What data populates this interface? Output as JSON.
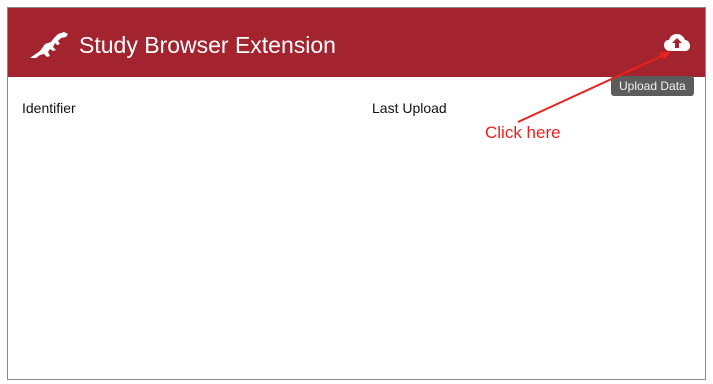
{
  "header": {
    "title": "Study Browser Extension",
    "logo_icon": "dinosaur-logo-icon",
    "background": "#a3232f",
    "upload_icon": "cloud-upload-icon",
    "upload_tooltip": "Upload Data"
  },
  "table": {
    "columns": [
      "Identifier",
      "Last Upload"
    ],
    "rows": []
  },
  "annotation": {
    "text": "Click here",
    "color": "#e8231f"
  }
}
